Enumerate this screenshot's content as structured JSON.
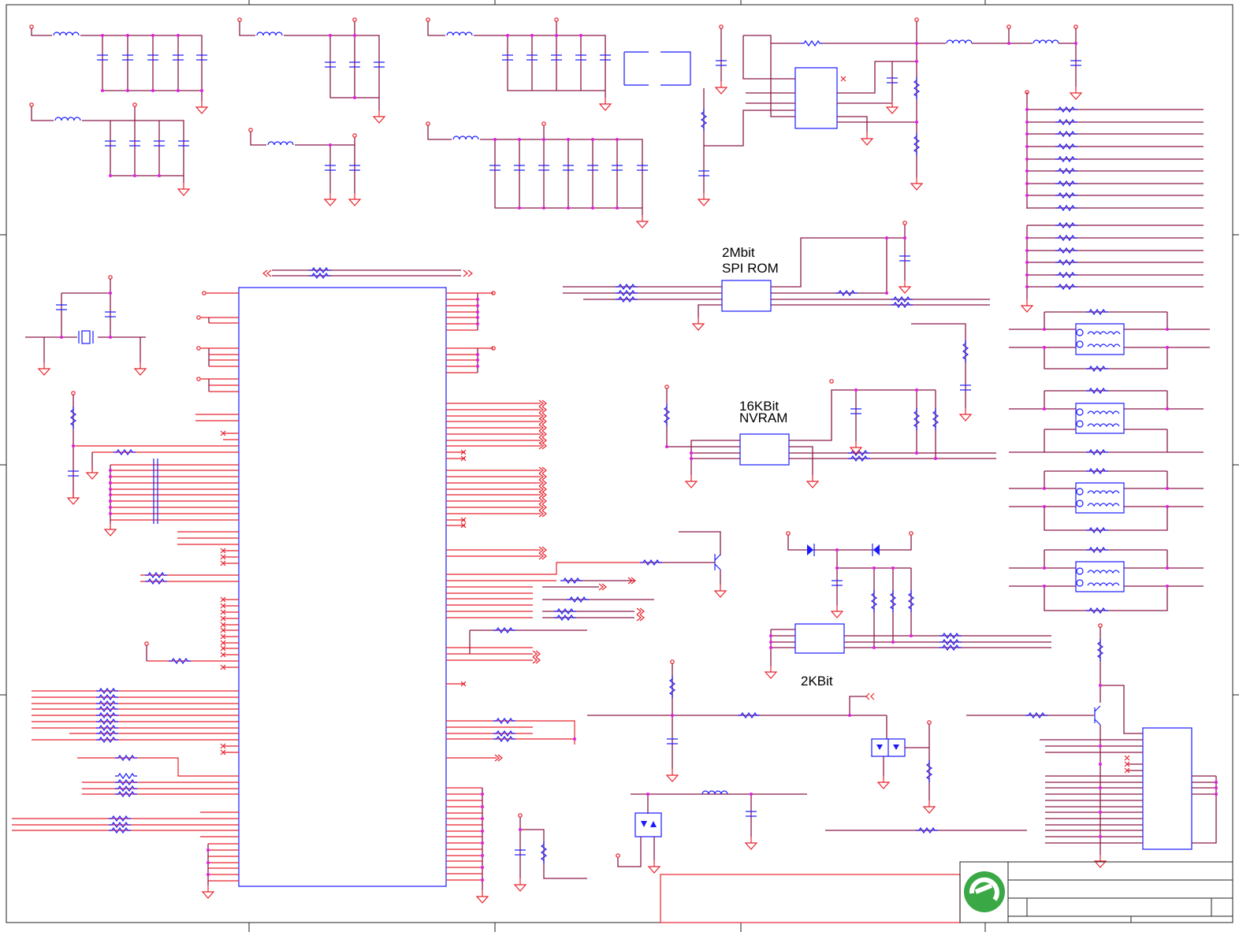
{
  "labels": {
    "rom_line1": "2Mbit",
    "rom_line2": "SPI ROM",
    "nvram_line1": "16KBit",
    "nvram_line2": "NVRAM",
    "eeprom": "2KBit"
  },
  "colors": {
    "wire": "#8b1a4a",
    "pin": "#e8232d",
    "component": "#1a1aff",
    "junction": "#e020e0",
    "logo": "#3aa845"
  },
  "icons": {
    "logo": "green-e-logo-icon"
  }
}
